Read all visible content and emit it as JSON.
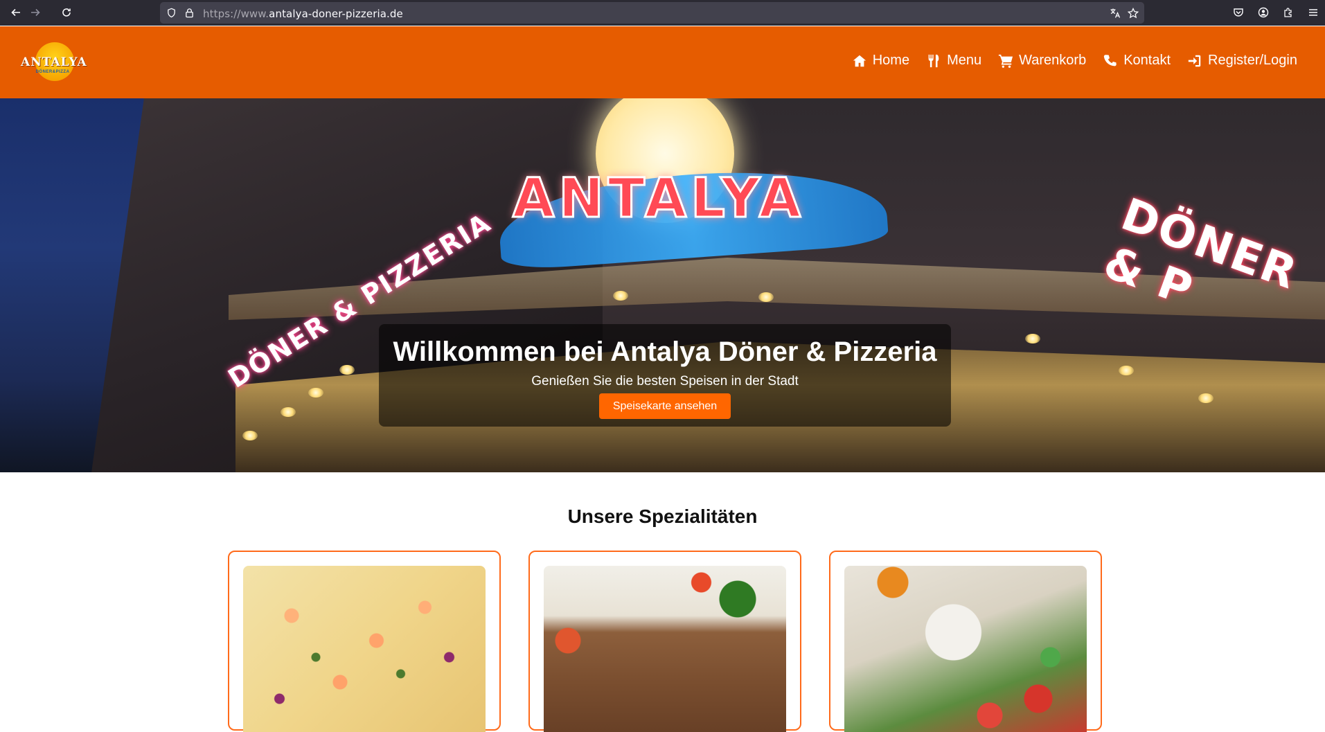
{
  "browser": {
    "url_prefix": "https://www.",
    "url_domain": "antalya-doner-pizzeria.de"
  },
  "logo": {
    "name": "ANTALYA",
    "sub": "DÖNER&PIZZA"
  },
  "nav": {
    "items": [
      {
        "label": "Home",
        "icon": "home-icon"
      },
      {
        "label": "Menu",
        "icon": "utensils-icon"
      },
      {
        "label": "Warenkorb",
        "icon": "cart-icon"
      },
      {
        "label": "Kontakt",
        "icon": "phone-icon"
      },
      {
        "label": "Register/Login",
        "icon": "login-icon"
      }
    ]
  },
  "hero": {
    "title": "Willkommen bei Antalya Döner & Pizzeria",
    "subtitle": "Genießen Sie die besten Speisen in der Stadt",
    "cta": "Speisekarte ansehen",
    "sign_main": "ANTALYA",
    "sign_left": "DÖNER & PIZZERIA",
    "sign_right": "DÖNER & P"
  },
  "specialties": {
    "title": "Unsere Spezialitäten",
    "cards": [
      {
        "image": "pizza"
      },
      {
        "image": "doner"
      },
      {
        "image": "salad"
      }
    ]
  },
  "colors": {
    "header": "#e65c00",
    "accent": "#ff6600",
    "card_border": "#ff6a1a"
  }
}
